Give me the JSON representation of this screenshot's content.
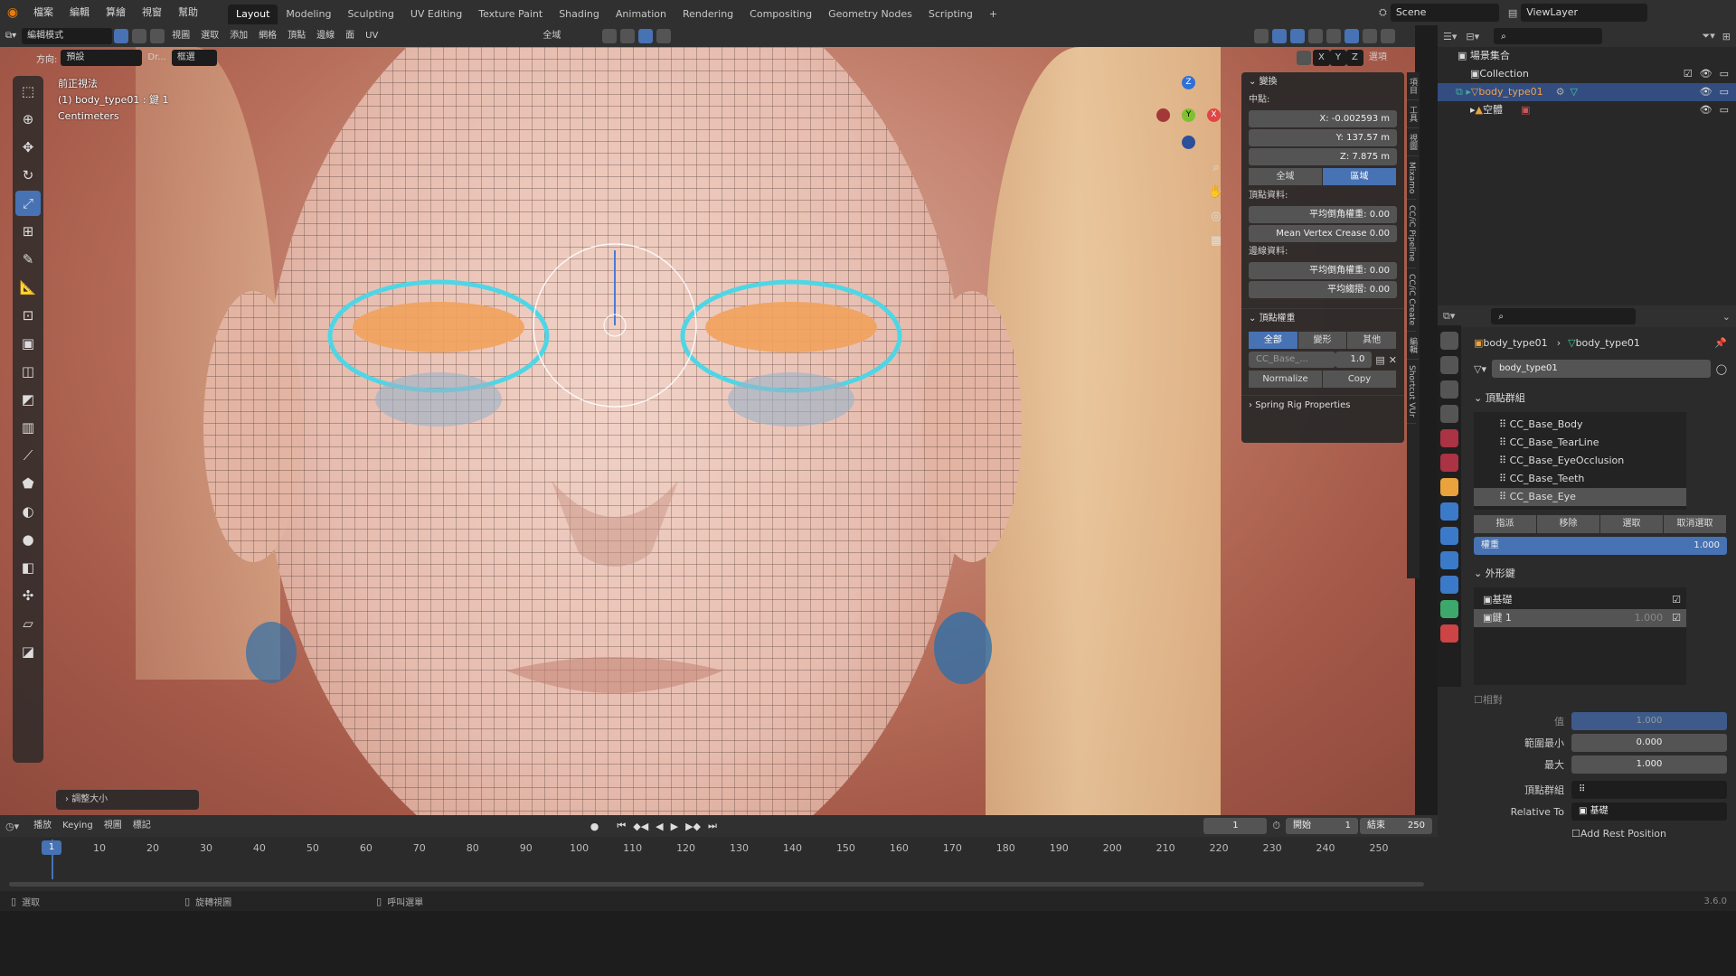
{
  "topbar": {
    "menus": [
      "檔案",
      "編輯",
      "算繪",
      "視窗",
      "幫助"
    ],
    "workspaces": [
      "Layout",
      "Modeling",
      "Sculpting",
      "UV Editing",
      "Texture Paint",
      "Shading",
      "Animation",
      "Rendering",
      "Compositing",
      "Geometry Nodes",
      "Scripting"
    ],
    "add_tab": "+",
    "scene_name": "Scene",
    "view_layer": "ViewLayer"
  },
  "viewport_header": {
    "mode": "編輯模式",
    "menus": [
      "視圖",
      "選取",
      "添加",
      "網格",
      "頂點",
      "邊線",
      "面",
      "UV"
    ],
    "orientation_label": "方向:",
    "orientation_value": "預設",
    "drag_label": "Dr...",
    "select_value": "框選",
    "pivot": "全域",
    "axes": [
      "X",
      "Y",
      "Z"
    ],
    "options": "選項"
  },
  "viewport": {
    "view_name": "前正視法",
    "object_info": "(1) body_type01 : 鍵 1",
    "units": "Centimeters",
    "operator_panel": "調整大小"
  },
  "gizmo": {
    "x": "X",
    "y": "Y",
    "z": "Z"
  },
  "npanel": {
    "transform_title": "變換",
    "median_label": "中點:",
    "x_value": "X:  -0.002593 m",
    "y_value": "Y:  137.57 m",
    "z_value": "Z:  7.875 m",
    "global_btn": "全域",
    "local_btn": "區域",
    "vertex_data_label": "頂點資料:",
    "vertex_bevel": "平均倒角權重:  0.00",
    "mean_vertex_crease": "Mean Vertex Crease  0.00",
    "edge_data_label": "邊線資料:",
    "edge_bevel": "平均倒角權重:  0.00",
    "edge_crease": "平均縐摺:  0.00",
    "vweights_title": "頂點權重",
    "vw_tabs": [
      "全部",
      "變形",
      "其他"
    ],
    "vw_group": "CC_Base_...",
    "vw_value": "1.0",
    "normalize": "Normalize",
    "copy": "Copy",
    "spring_rig": "Spring Rig Properties"
  },
  "vtabs": [
    "項目",
    "工具",
    "視圖",
    "Mixamo",
    "CC/iC Pipeline",
    "CC/iC Create",
    "編輯",
    "Shortcut VUr"
  ],
  "outliner": {
    "root": "場景集合",
    "collection": "Collection",
    "object": "body_type01",
    "empty": "空體"
  },
  "properties": {
    "breadcrumb_a": "body_type01",
    "breadcrumb_b": "body_type01",
    "mesh_name": "body_type01",
    "vgroups_title": "頂點群組",
    "vgroups": [
      "CC_Base_Body",
      "CC_Base_TearLine",
      "CC_Base_EyeOcclusion",
      "CC_Base_Teeth",
      "CC_Base_Eye"
    ],
    "assign": "指派",
    "remove": "移除",
    "select": "選取",
    "deselect": "取消選取",
    "weight_label": "權重",
    "weight_value": "1.000",
    "shapekeys_title": "外形鍵",
    "keys": [
      {
        "name": "基礎",
        "value": ""
      },
      {
        "name": "鍵 1",
        "value": "1.000"
      }
    ],
    "relative": "相對",
    "value_label": "值",
    "value_value": "1.000",
    "range_min_label": "範圍最小",
    "range_min": "0.000",
    "max_label": "最大",
    "max_value": "1.000",
    "vgroup_label": "頂點群組",
    "relative_to_label": "Relative To",
    "relative_to_value": "基礎",
    "add_rest": "Add Rest Position"
  },
  "timeline": {
    "playback": "播放",
    "keying": "Keying",
    "view": "視圖",
    "marker": "標記",
    "current_frame": "1",
    "start_label": "開始",
    "start": "1",
    "end_label": "結束",
    "end": "250",
    "current_marker": "1",
    "ticks": [
      "10",
      "20",
      "30",
      "40",
      "50",
      "60",
      "70",
      "80",
      "90",
      "100",
      "110",
      "120",
      "130",
      "140",
      "150",
      "160",
      "170",
      "180",
      "190",
      "200",
      "210",
      "220",
      "230",
      "240",
      "250"
    ]
  },
  "statusbar": {
    "select": "選取",
    "rotate": "旋轉視圖",
    "call_menu": "呼叫選單",
    "version": "3.6.0"
  }
}
